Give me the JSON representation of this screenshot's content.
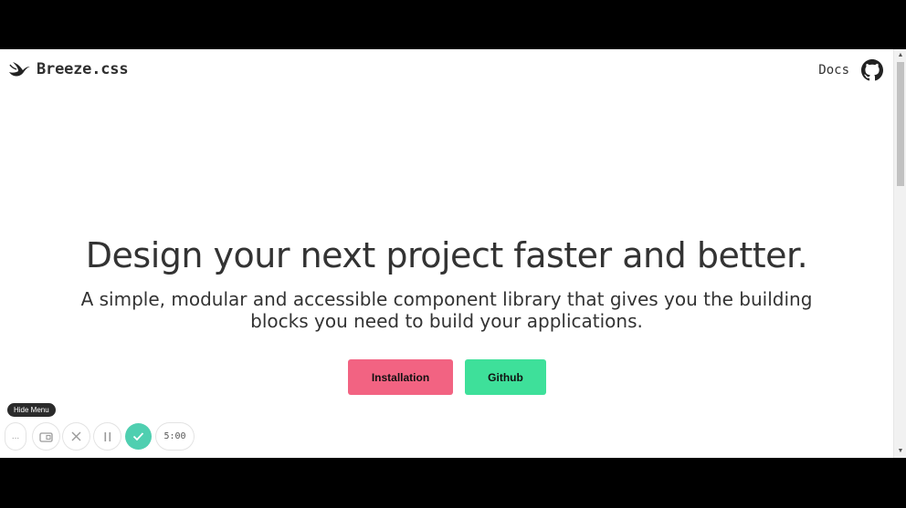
{
  "navbar": {
    "brand_name": "Breeze.css",
    "docs_label": "Docs"
  },
  "hero": {
    "title": "Design your next project faster and better.",
    "subtitle": "A simple, modular and accessible component library that gives you the building blocks you need to build your applications.",
    "buttons": {
      "installation": "Installation",
      "github": "Github"
    }
  },
  "colors": {
    "install_button": "#f26382",
    "github_button": "#3ee09a",
    "text": "#333333",
    "recorder_accent": "#4fcfb0"
  },
  "recorder": {
    "hide_menu_label": "Hide Menu",
    "more_icon": "...",
    "timer": "5:00"
  },
  "icons": [
    "swallow-logo-icon",
    "github-icon",
    "camera-icon",
    "close-icon",
    "pause-icon",
    "check-icon"
  ]
}
